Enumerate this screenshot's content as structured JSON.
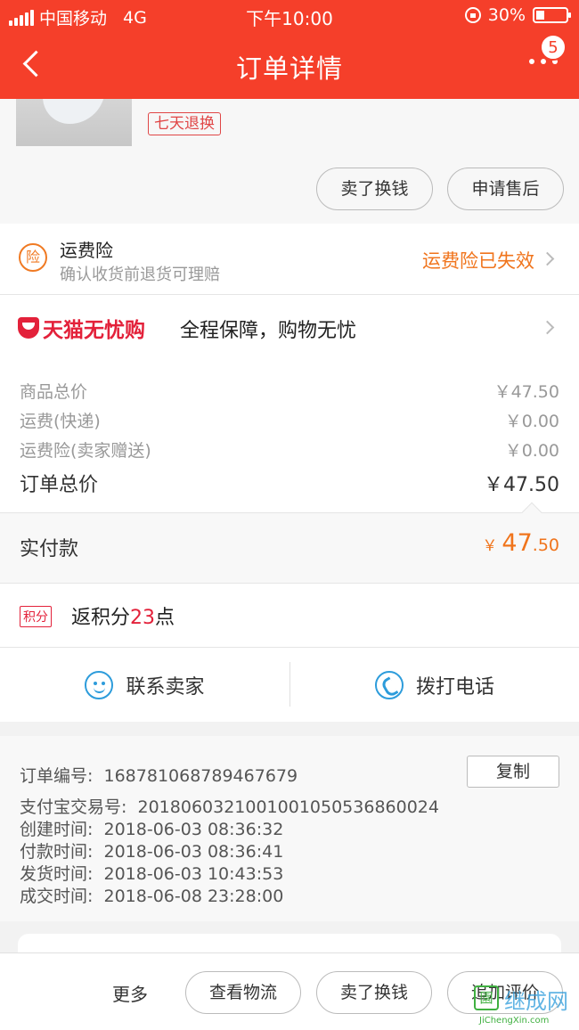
{
  "status_bar": {
    "carrier": "中国移动",
    "network": "4G",
    "time": "下午10:00",
    "battery": "30%"
  },
  "header": {
    "title": "订单详情",
    "badge_count": "5"
  },
  "product": {
    "tag": "七天退换",
    "buttons": [
      "卖了换钱",
      "申请售后"
    ]
  },
  "insurance": {
    "icon_char": "险",
    "title": "运费险",
    "subtitle": "确认收货前退货可理赔",
    "status": "运费险已失效"
  },
  "tmall": {
    "logo_text": "天猫无忧购",
    "description": "全程保障，购物无忧"
  },
  "prices": [
    {
      "label": "商品总价",
      "value": "￥47.50"
    },
    {
      "label": "运费(快递)",
      "value": "￥0.00"
    },
    {
      "label": "运费险(卖家赠送)",
      "value": "￥0.00"
    }
  ],
  "order_total": {
    "label": "订单总价",
    "value": "￥47.50"
  },
  "paid": {
    "label": "实付款",
    "currency": "￥",
    "integer": "47",
    "decimal": ".50"
  },
  "points": {
    "tag": "积分",
    "prefix": "返积分",
    "number": "23",
    "suffix": "点"
  },
  "contact": {
    "seller": "联系卖家",
    "phone": "拨打电话"
  },
  "order_info": {
    "copy_label": "复制",
    "rows": [
      {
        "label": "订单编号:",
        "value": "168781068789467679"
      },
      {
        "label": "支付宝交易号:",
        "value": "2018060321001001050536860024"
      },
      {
        "label": "创建时间:",
        "value": "2018-06-03 08:36:32"
      },
      {
        "label": "付款时间:",
        "value": "2018-06-03 08:36:41"
      },
      {
        "label": "发货时间:",
        "value": "2018-06-03 10:43:53"
      },
      {
        "label": "成交时间:",
        "value": "2018-06-08 23:28:00"
      }
    ]
  },
  "bottom_bar": {
    "more": "更多",
    "buttons": [
      "查看物流",
      "卖了换钱",
      "追加评价"
    ]
  },
  "watermark": {
    "name": "继成网",
    "url": "JiChengXin.com"
  },
  "colors": {
    "brand_red": "#f53f2a",
    "orange": "#f0741c",
    "tmall_red": "#e3213a",
    "blue": "#2d9cdb"
  }
}
